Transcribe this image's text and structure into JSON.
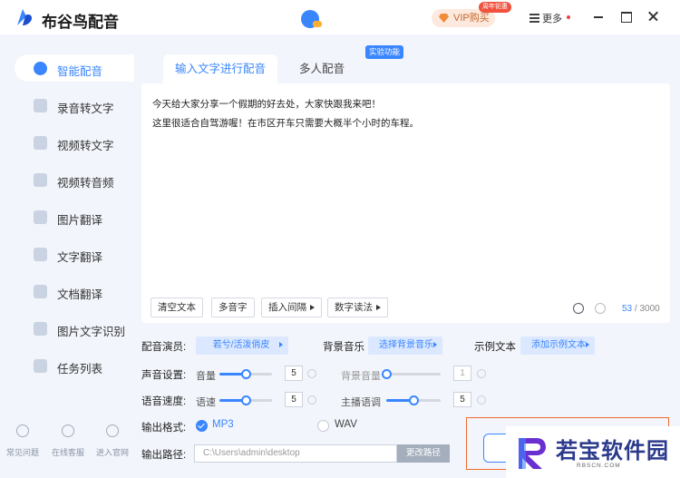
{
  "app": {
    "title": "布谷鸟配音",
    "brand_color": "#3a86ff"
  },
  "titlebar": {
    "vip_label": "VIP购买",
    "vip_badge": "周年钜惠",
    "more_label": "更多"
  },
  "sidebar": {
    "items": [
      {
        "label": "智能配音",
        "icon": "microphone-icon",
        "active": true
      },
      {
        "label": "录音转文字",
        "icon": "recording-icon"
      },
      {
        "label": "视频转文字",
        "icon": "video-icon"
      },
      {
        "label": "视频转音频",
        "icon": "video-audio-icon"
      },
      {
        "label": "图片翻译",
        "icon": "image-translate-icon"
      },
      {
        "label": "文字翻译",
        "icon": "text-translate-icon"
      },
      {
        "label": "文档翻译",
        "icon": "doc-translate-icon"
      },
      {
        "label": "图片文字识别",
        "icon": "ocr-icon"
      },
      {
        "label": "任务列表",
        "icon": "task-list-icon"
      }
    ],
    "bottom": [
      {
        "label": "常见问题",
        "icon": "question-icon"
      },
      {
        "label": "在线客服",
        "icon": "chat-icon"
      },
      {
        "label": "进入官网",
        "icon": "bird-icon"
      }
    ]
  },
  "main": {
    "tabs": [
      {
        "label": "输入文字进行配音"
      },
      {
        "label": "多人配音"
      }
    ],
    "lab_badge": "实验功能",
    "editor": {
      "lines": [
        "今天给大家分享一个假期的好去处，大家快跟我来吧！",
        "这里很适合自驾游喔！在市区开车只需要大概半个小时的车程。"
      ]
    },
    "tools": [
      {
        "label": "清空文本",
        "arrow": false
      },
      {
        "label": "多音字",
        "arrow": false
      },
      {
        "label": "插入间隔",
        "arrow": true
      },
      {
        "label": "数字读法",
        "arrow": true
      }
    ],
    "counter": {
      "current": "53",
      "total": " / 3000"
    },
    "settings": {
      "voice_label": "配音演员:",
      "voice_value": "若兮/活泼俏皮",
      "bgm_label": "背景音乐",
      "bgm_value": "选择背景音乐",
      "sample_label": "示例文本",
      "sample_value": "添加示例文本",
      "sound_label": "声音设置:",
      "volume_label": "音量",
      "volume_value": "5",
      "volume_level": 0.5,
      "bg_volume_label": "背景音量",
      "bg_volume_value": "1",
      "bg_volume_level": 0.0,
      "speed_label": "语音速度:",
      "rate_label": "语速",
      "rate_value": "5",
      "rate_level": 0.5,
      "tone_label": "主播语调",
      "tone_value": "5",
      "tone_level": 0.5
    },
    "output": {
      "format_label": "输出格式:",
      "formats": [
        {
          "label": "MP3",
          "selected": true
        },
        {
          "label": "WAV",
          "selected": false
        }
      ],
      "path_label": "输出路径:",
      "path_value": "C:\\Users\\admin\\desktop",
      "change_path_label": "更改路径"
    }
  },
  "watermark": {
    "text": "若宝软件园",
    "url": "RBSCN.COM"
  }
}
